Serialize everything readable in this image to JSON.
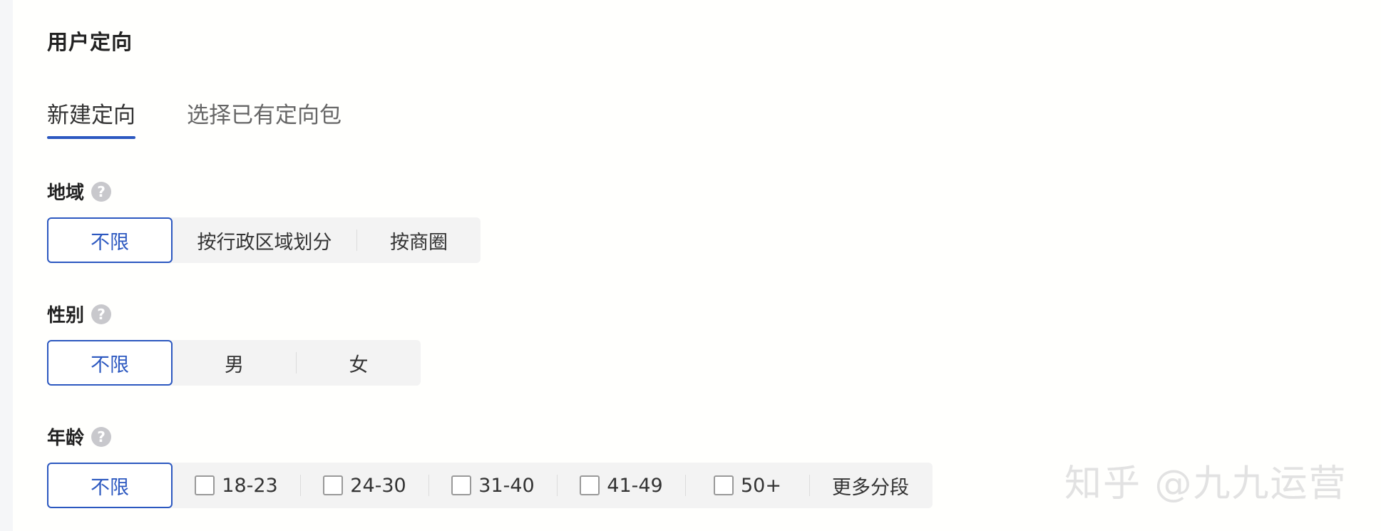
{
  "section": {
    "title": "用户定向"
  },
  "tabs": [
    {
      "label": "新建定向",
      "active": true
    },
    {
      "label": "选择已有定向包",
      "active": false
    }
  ],
  "region": {
    "label": "地域",
    "help": "?",
    "options": [
      {
        "label": "不限",
        "selected": true
      },
      {
        "label": "按行政区域划分",
        "selected": false
      },
      {
        "label": "按商圈",
        "selected": false
      }
    ]
  },
  "gender": {
    "label": "性别",
    "help": "?",
    "options": [
      {
        "label": "不限",
        "selected": true
      },
      {
        "label": "男",
        "selected": false
      },
      {
        "label": "女",
        "selected": false
      }
    ]
  },
  "age": {
    "label": "年龄",
    "help": "?",
    "unlimited": {
      "label": "不限",
      "selected": true
    },
    "ranges": [
      {
        "label": "18-23",
        "checked": false
      },
      {
        "label": "24-30",
        "checked": false
      },
      {
        "label": "31-40",
        "checked": false
      },
      {
        "label": "41-49",
        "checked": false
      },
      {
        "label": "50+",
        "checked": false
      }
    ],
    "more": "更多分段"
  },
  "watermark": "知乎 @九九运营",
  "colors": {
    "accent": "#2c58c0",
    "segment_bg": "#f3f3f3"
  }
}
